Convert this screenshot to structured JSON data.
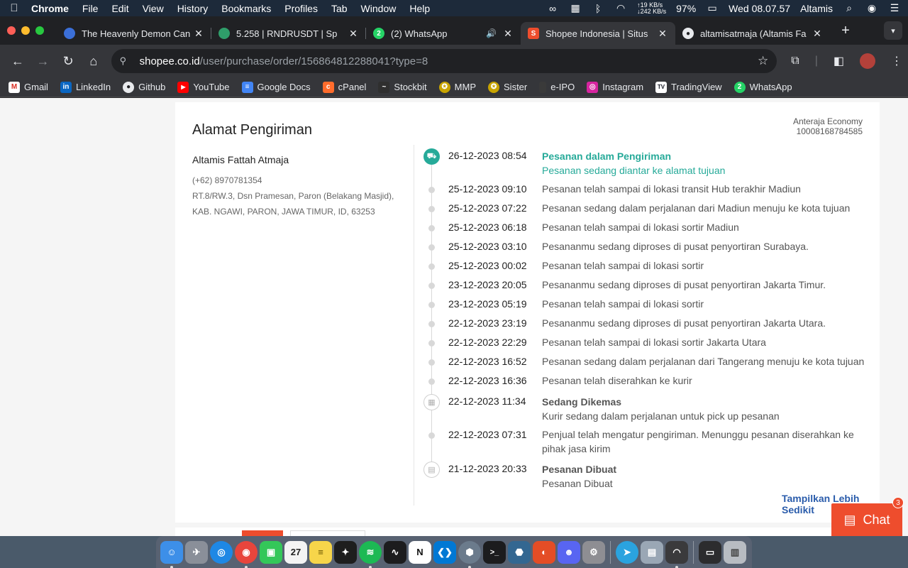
{
  "menubar": {
    "app_name": "Chrome",
    "menus": [
      "File",
      "Edit",
      "View",
      "History",
      "Bookmarks",
      "Profiles",
      "Tab",
      "Window",
      "Help"
    ],
    "net_up": "↑19 KB/s",
    "net_down": "↓242 KB/s",
    "battery": "97%",
    "clock": "Wed 08.07.57",
    "user": "Altamis"
  },
  "tabs": [
    {
      "title": "The Heavenly Demon Can",
      "favicon_color": "#3b6fd8"
    },
    {
      "title": "5.258 | RNDRUSDT | Sp",
      "favicon_color": "#2f9e6a"
    },
    {
      "title": "(2) WhatsApp",
      "favicon_color": "#25d366"
    },
    {
      "title": "Shopee Indonesia | Situs",
      "favicon_color": "#ee4d2d"
    },
    {
      "title": "altamisatmaja (Altamis Fa",
      "favicon_color": "#e8eaed"
    }
  ],
  "omnibox": {
    "host": "shopee.co.id",
    "path": "/user/purchase/order/156864812288041?type=8"
  },
  "bookmarks": [
    {
      "label": "Gmail",
      "color": "#d93025",
      "glyph": "M"
    },
    {
      "label": "LinkedIn",
      "color": "#0a66c2",
      "glyph": "in"
    },
    {
      "label": "Github",
      "color": "#e8eaed",
      "glyph": "●"
    },
    {
      "label": "YouTube",
      "color": "#ff0000",
      "glyph": "▶"
    },
    {
      "label": "Google Docs",
      "color": "#4285f4",
      "glyph": "≡"
    },
    {
      "label": "cPanel",
      "color": "#ff6c2c",
      "glyph": "c"
    },
    {
      "label": "Stockbit",
      "color": "#2f2f2f",
      "glyph": "~"
    },
    {
      "label": "MMP",
      "color": "#c8a400",
      "glyph": "✪"
    },
    {
      "label": "Sister",
      "color": "#c8a400",
      "glyph": "✪"
    },
    {
      "label": "e-IPO",
      "color": "#3a3a3a",
      "glyph": "▯"
    },
    {
      "label": "Instagram",
      "color": "#d6249f",
      "glyph": "◎"
    },
    {
      "label": "TradingView",
      "color": "#131722",
      "glyph": "TV"
    },
    {
      "label": "WhatsApp",
      "color": "#25d366",
      "glyph": "2"
    }
  ],
  "shipping": {
    "section_title": "Alamat Pengiriman",
    "courier_name": "Anteraja Economy",
    "tracking_number": "10008168784585",
    "recipient_name": "Altamis Fattah Atmaja",
    "phone": "(+62) 8970781354",
    "address_line1": "RT.8/RW.3, Dsn Pramesan, Paron (Belakang Masjid),",
    "address_line2": "KAB. NGAWI, PARON, JAWA TIMUR, ID, 63253"
  },
  "timeline": [
    {
      "time": "26-12-2023 08:54",
      "head": "Pesanan dalam Pengiriman",
      "desc": "Pesanan sedang diantar ke alamat tujuan",
      "icon": "truck-icon"
    },
    {
      "time": "25-12-2023 09:10",
      "desc": "Pesanan telah sampai di lokasi transit Hub terakhir Madiun"
    },
    {
      "time": "25-12-2023 07:22",
      "desc": "Pesanan sedang dalam perjalanan dari Madiun menuju ke kota tujuan"
    },
    {
      "time": "25-12-2023 06:18",
      "desc": "Pesanan telah sampai di lokasi sortir Madiun"
    },
    {
      "time": "25-12-2023 03:10",
      "desc": "Pesananmu sedang diproses di pusat penyortiran Surabaya."
    },
    {
      "time": "25-12-2023 00:02",
      "desc": "Pesanan telah sampai di lokasi sortir"
    },
    {
      "time": "23-12-2023 20:05",
      "desc": "Pesananmu sedang diproses di pusat penyortiran Jakarta Timur."
    },
    {
      "time": "23-12-2023 05:19",
      "desc": "Pesanan telah sampai di lokasi sortir"
    },
    {
      "time": "22-12-2023 23:19",
      "desc": "Pesananmu sedang diproses di pusat penyortiran Jakarta Utara."
    },
    {
      "time": "22-12-2023 22:29",
      "desc": "Pesanan telah sampai di lokasi sortir Jakarta Utara"
    },
    {
      "time": "22-12-2023 16:52",
      "desc": "Pesanan sedang dalam perjalanan dari Tangerang menuju ke kota tujuan"
    },
    {
      "time": "22-12-2023 16:36",
      "desc": "Pesanan telah diserahkan ke kurir"
    },
    {
      "time": "22-12-2023 11:34",
      "head": "Sedang Dikemas",
      "desc": "Kurir sedang dalam perjalanan untuk pick up pesanan",
      "icon": "package-icon"
    },
    {
      "time": "22-12-2023 07:31",
      "desc": "Penjual telah mengatur pengiriman. Menunggu pesanan diserahkan ke pihak jasa kirim"
    },
    {
      "time": "21-12-2023 20:33",
      "head": "Pesanan Dibuat",
      "desc": "Pesanan Dibuat",
      "icon": "receipt-icon"
    }
  ],
  "show_less_label": "Tampilkan Lebih Sedikit",
  "chat": {
    "label": "Chat",
    "badge": "3"
  },
  "dock": [
    {
      "name": "finder-icon",
      "color": "#3d8fe8",
      "glyph": "☺"
    },
    {
      "name": "launchpad-icon",
      "color": "#8a8f99",
      "glyph": "✈"
    },
    {
      "name": "safari-icon",
      "color": "#1e88e5",
      "glyph": "◎"
    },
    {
      "name": "chrome-icon",
      "color": "#e8453c",
      "glyph": "◉"
    },
    {
      "name": "facetime-icon",
      "color": "#34c759",
      "glyph": "▣"
    },
    {
      "name": "calendar-icon",
      "color": "#f4f4f4",
      "glyph": "27"
    },
    {
      "name": "notes-icon",
      "color": "#f7d54a",
      "glyph": "≡"
    },
    {
      "name": "figma-icon",
      "color": "#1e1e1e",
      "glyph": "✦"
    },
    {
      "name": "spotify-icon",
      "color": "#1db954",
      "glyph": "≋"
    },
    {
      "name": "stocks-icon",
      "color": "#1c1c1e",
      "glyph": "∿"
    },
    {
      "name": "notion-icon",
      "color": "#ffffff",
      "glyph": "N"
    },
    {
      "name": "vscode-icon",
      "color": "#0078d4",
      "glyph": "❮❯"
    },
    {
      "name": "tableplus-icon",
      "color": "#6b7b8c",
      "glyph": "⬢"
    },
    {
      "name": "terminal-icon",
      "color": "#1c1c1e",
      "glyph": ">_"
    },
    {
      "name": "postgres-icon",
      "color": "#336791",
      "glyph": "🐘"
    },
    {
      "name": "adobe-icon",
      "color": "#e44d26",
      "glyph": "◐"
    },
    {
      "name": "discord-icon",
      "color": "#5865f2",
      "glyph": "☻"
    },
    {
      "name": "system-settings-icon",
      "color": "#8e8e93",
      "glyph": "⚙"
    },
    {
      "name": "telegram-icon",
      "color": "#2aa3df",
      "glyph": "➤"
    },
    {
      "name": "preview-icon",
      "color": "#9aa7b5",
      "glyph": "▤"
    },
    {
      "name": "wifi-utility-icon",
      "color": "#3a3a3c",
      "glyph": "◠"
    },
    {
      "name": "desktop-stack-icon",
      "color": "#2c2c2e",
      "glyph": "▭"
    },
    {
      "name": "trash-icon",
      "color": "#b8bcc2",
      "glyph": "🗑"
    }
  ]
}
